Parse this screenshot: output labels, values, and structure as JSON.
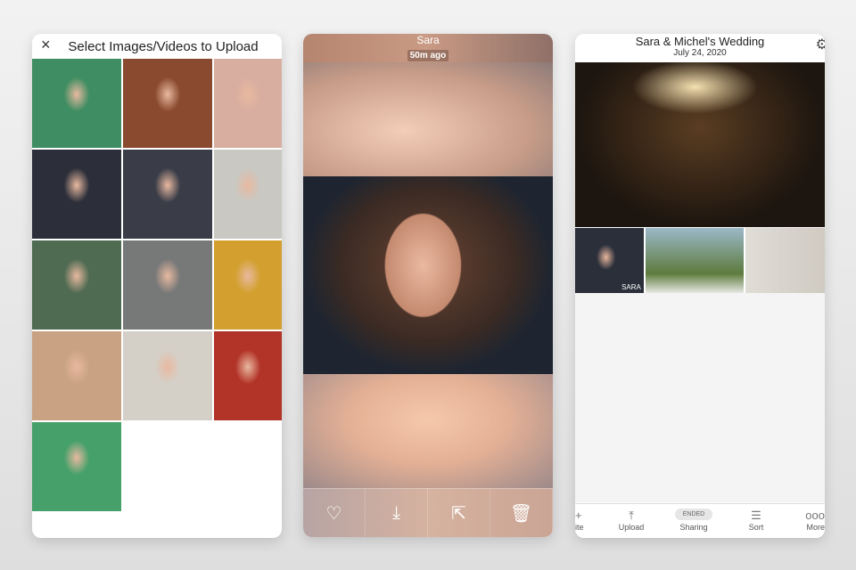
{
  "left": {
    "title": "Select Images/Videos to Upload",
    "close_icon": "×",
    "photo_count": 13,
    "photos": [
      "#3f8d62",
      "#8a4a30",
      "#d8aea0",
      "#2c2f3a",
      "#3a3d48",
      "#c9c8c2",
      "#4f6b52",
      "#777878",
      "#d3a030",
      "#c9a283",
      "#d4d0c8",
      "#b23328",
      "#45a06a"
    ]
  },
  "middle": {
    "name": "Sara",
    "time": "50m ago",
    "actions": [
      "heart-icon",
      "download-icon",
      "share-icon",
      "trash-icon"
    ]
  },
  "right": {
    "title": "Sara & Michel's Wedding",
    "date": "July 24, 2020",
    "thumb_label": "SARA",
    "tabs": [
      {
        "label": "ite",
        "icon": "+"
      },
      {
        "label": "Upload",
        "icon": "⤒"
      },
      {
        "label": "Sharing",
        "badge": "ENDED"
      },
      {
        "label": "Sort",
        "icon": "☰"
      },
      {
        "label": "More",
        "icon": "ooo"
      }
    ]
  }
}
